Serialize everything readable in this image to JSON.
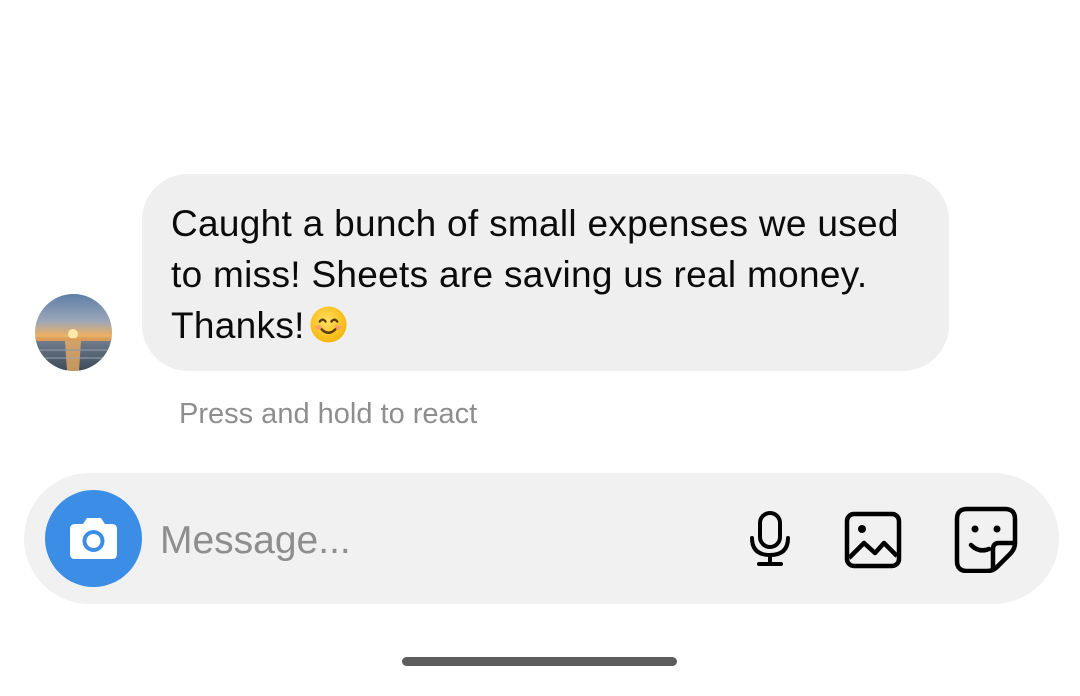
{
  "conversation": {
    "message": {
      "text": "Caught a bunch of small expenses we used to miss! Sheets are saving us real money. Thanks!",
      "emoji_icon": "smiling-face-emoji",
      "avatar": "sunset-beach-avatar"
    },
    "hint": "Press and hold to react"
  },
  "composer": {
    "placeholder": "Message...",
    "camera_icon": "camera-icon",
    "mic_icon": "microphone-icon",
    "gallery_icon": "image-gallery-icon",
    "sticker_icon": "sticker-icon",
    "accent_color": "#3b8de6"
  }
}
